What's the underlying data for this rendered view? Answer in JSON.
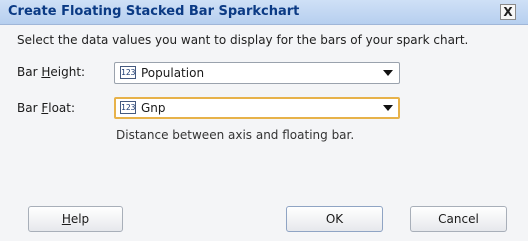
{
  "window": {
    "title": "Create Floating Stacked Bar Sparkchart",
    "close_glyph": "X"
  },
  "instruction": "Select the data values you want to display for the bars of your spark chart.",
  "fields": {
    "bar_height": {
      "label_before": "Bar ",
      "label_mnemonic": "H",
      "label_after": "eight:",
      "type_icon_text": "123",
      "value": "Population"
    },
    "bar_float": {
      "label_before": "Bar ",
      "label_mnemonic": "F",
      "label_after": "loat:",
      "type_icon_text": "123",
      "value": "Gnp",
      "hint": "Distance between axis and floating bar."
    }
  },
  "buttons": {
    "help_mnemonic": "H",
    "help_rest": "elp",
    "ok": "OK",
    "cancel": "Cancel"
  },
  "icons": {
    "type": "numeric-type-icon",
    "dropdown": "chevron-down-icon",
    "close": "close-icon"
  },
  "colors": {
    "title_text": "#0b3a84",
    "focus_border": "#e7b24a",
    "dialog_background": "#f4f5f7"
  }
}
